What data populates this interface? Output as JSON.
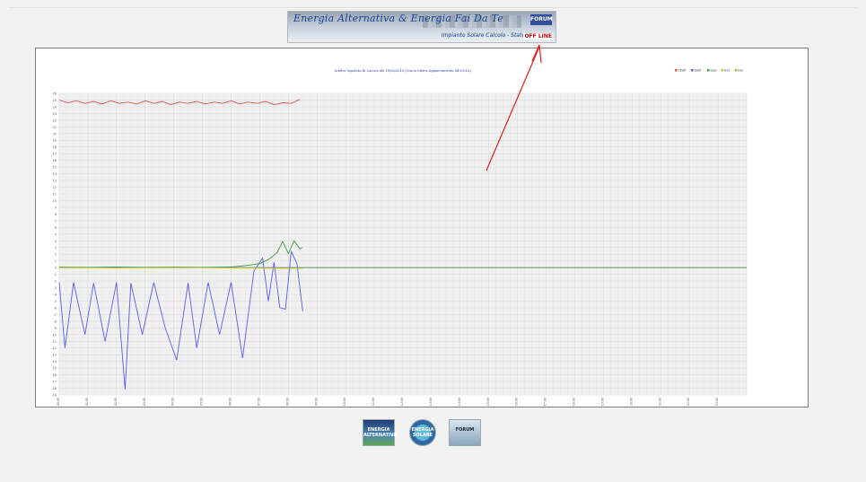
{
  "banner": {
    "title": "Energia Alternativa & Energia Fai Da Te",
    "forum": "FORUM",
    "subtitle": "Impianto Solare Calcolo - Stato",
    "status": "OFF LINE"
  },
  "chart_data": {
    "type": "line",
    "title": "Grafico Impianto Di Calcolo del 15/04/2010 (Orario Ultimo Aggiornamento 08:03:44 )",
    "legend_position": "top-right",
    "grid": true,
    "ylim": [
      -19,
      26
    ],
    "yticks": [
      26,
      25,
      24,
      23,
      22,
      21,
      20,
      19,
      18,
      17,
      16,
      15,
      14,
      13,
      12,
      11,
      10,
      9,
      8,
      7,
      6,
      5,
      4,
      3,
      2,
      1,
      0,
      -1,
      -2,
      -3,
      -4,
      -5,
      -6,
      -7,
      -8,
      -9,
      -10,
      -11,
      -12,
      -13,
      -14,
      -15,
      -16,
      -17,
      -18,
      -19
    ],
    "x_tick_labels": [
      "00:00",
      "01:00",
      "02:00",
      "03:00",
      "04:00",
      "05:00",
      "06:00",
      "07:00",
      "08:00",
      "09:00",
      "10:00",
      "11:00",
      "12:00",
      "13:00",
      "14:00",
      "15:00",
      "16:00",
      "17:00",
      "18:00",
      "19:00",
      "20:00",
      "21:00",
      "22:00",
      "23:00"
    ],
    "series": [
      {
        "name": "Vbatt",
        "color": "#e2504f",
        "x": [
          0,
          0.3,
          0.6,
          0.9,
          1.2,
          1.5,
          1.8,
          2.1,
          2.4,
          2.7,
          3.0,
          3.3,
          3.6,
          3.9,
          4.2,
          4.5,
          4.8,
          5.1,
          5.4,
          5.7,
          6.0,
          6.3,
          6.6,
          6.9,
          7.2,
          7.5,
          7.8,
          8.1,
          8.4
        ],
        "values": [
          25,
          24.6,
          24.9,
          24.5,
          24.8,
          24.4,
          24.9,
          24.5,
          24.7,
          24.4,
          24.9,
          24.5,
          24.8,
          24.3,
          24.7,
          24.5,
          24.8,
          24.4,
          24.7,
          24.5,
          24.9,
          24.4,
          24.7,
          24.5,
          24.8,
          24.3,
          24.6,
          24.5,
          25.1
        ]
      },
      {
        "name": "Ibatt",
        "color": "#5b5bf0",
        "x": [
          0,
          0.2,
          0.5,
          0.9,
          1.2,
          1.6,
          2.0,
          2.3,
          2.5,
          2.9,
          3.3,
          3.7,
          4.1,
          4.5,
          4.8,
          5.2,
          5.6,
          6.0,
          6.4,
          6.8,
          7.1,
          7.3,
          7.5,
          7.7,
          7.9,
          8.1,
          8.3,
          8.5
        ],
        "values": [
          -2.2,
          -12,
          -2.2,
          -10,
          -2.3,
          -11,
          -2.2,
          -18.2,
          -2.3,
          -10,
          -2.2,
          -9,
          -13.8,
          -2.3,
          -12,
          -2.2,
          -10,
          -2.2,
          -13.5,
          -0.5,
          1.4,
          -5,
          0.8,
          -6,
          -6.2,
          2.4,
          0.6,
          -6.5
        ]
      },
      {
        "name": "Ipan",
        "color": "#3c9c3c",
        "x": [
          0,
          1,
          2,
          3,
          4,
          5,
          6,
          6.5,
          7.0,
          7.3,
          7.6,
          7.8,
          8.0,
          8.2,
          8.4,
          8.5
        ],
        "values": [
          0.1,
          0.05,
          0.1,
          0.05,
          0.1,
          0.05,
          0.1,
          0.3,
          0.6,
          1.2,
          2.2,
          3.9,
          2.1,
          4.0,
          2.8,
          3.0
        ]
      },
      {
        "name": "Icar",
        "color": "#c8c832",
        "x": [
          0,
          2,
          4,
          6,
          8,
          8.5
        ],
        "values": [
          0,
          -0.05,
          0,
          -0.05,
          -0.1,
          -0.1
        ]
      },
      {
        "name": "Isol",
        "color": "#8fb83a",
        "x": [],
        "values": []
      }
    ]
  },
  "logos": [
    {
      "label": "ENERGIA ALTERNATIVA"
    },
    {
      "label": "ENERGIA SOLARE"
    },
    {
      "label": "FORUM"
    }
  ]
}
